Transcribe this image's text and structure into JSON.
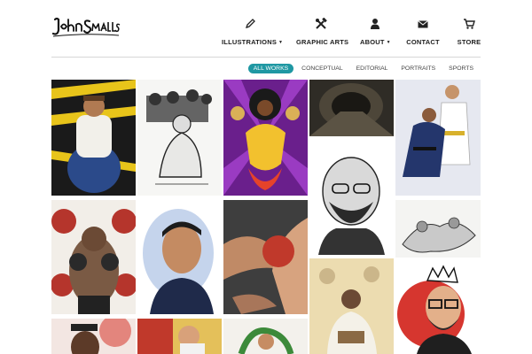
{
  "logo": {
    "alt": "John Smalls"
  },
  "nav": {
    "items": [
      {
        "label": "ILLUSTRATIONS",
        "icon": "pencil-icon",
        "has_dropdown": true
      },
      {
        "label": "GRAPHIC ARTS",
        "icon": "crossed-tools-icon",
        "has_dropdown": false
      },
      {
        "label": "ABOUT",
        "icon": "person-icon",
        "has_dropdown": true
      },
      {
        "label": "CONTACT",
        "icon": "envelope-icon",
        "has_dropdown": false
      },
      {
        "label": "STORE",
        "icon": "cart-icon",
        "has_dropdown": false
      }
    ]
  },
  "filters": {
    "active": "ALL WORKS",
    "items": [
      "ALL WORKS",
      "CONCEPTUAL",
      "EDITORIAL",
      "PORTRAITS",
      "SPORTS"
    ]
  },
  "colors": {
    "accent": "#1f98a3",
    "text": "#1d1d1d",
    "rule": "#d6d6d6"
  },
  "gallery": {
    "tiles": [
      "caution-tape-illustration",
      "kneeling-man-sketch",
      "psychedelic-figure-illustration",
      "tunnel-photo",
      "judo-blackbelt-illustration",
      "boxing-gloves-illustration",
      "bald-bearded-man-portrait",
      "man-portrait-watercolor",
      "grappling-arms-illustration",
      "wrestling-sketch",
      "judo-reading-illustration",
      "crowned-hipster-portrait",
      "boxer-portrait-red",
      "comic-fighters-illustration",
      "green-snake-illustration"
    ]
  }
}
